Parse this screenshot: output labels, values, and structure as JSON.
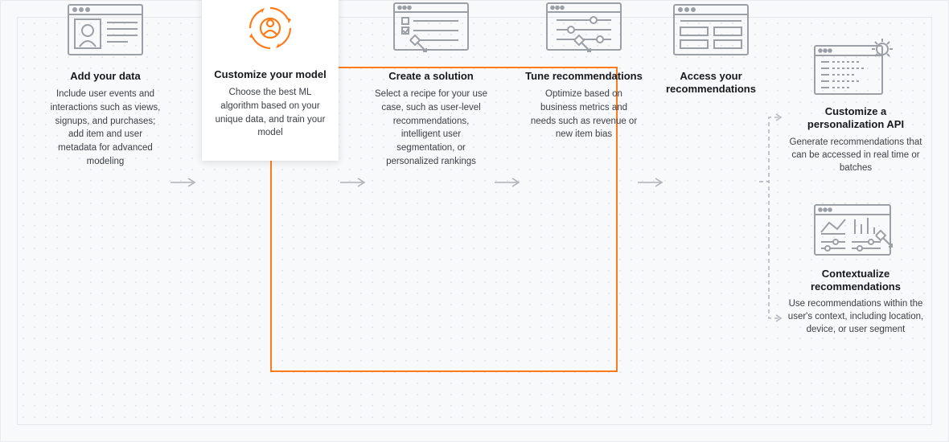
{
  "steps": [
    {
      "title": "Add your data",
      "desc": "Include user events and interactions such as views, signups, and purchases; add item and user metadata for advanced modeling"
    },
    {
      "title": "Customize your model",
      "desc": "Choose the best ML algorithm based on your unique data, and train your model"
    },
    {
      "title": "Create a solution",
      "desc": "Select a recipe for your use case, such as user-level recommendations, intelligent user segmentation, or personalized rankings"
    },
    {
      "title": "Tune recommendations",
      "desc": "Optimize based on business metrics and needs such as revenue or new item bias"
    },
    {
      "title": "Access your recommendations",
      "desc": ""
    }
  ],
  "outputs": [
    {
      "title": "Customize a personalization API",
      "desc": "Generate recommendations that can be accessed in real time or batches"
    },
    {
      "title": "Contextualize recommendations",
      "desc": "Use recommendations within the user's context, including location, device, or user segment"
    }
  ],
  "colors": {
    "accent": "#ff7b1a",
    "icon_gray": "#9aa0a6"
  }
}
